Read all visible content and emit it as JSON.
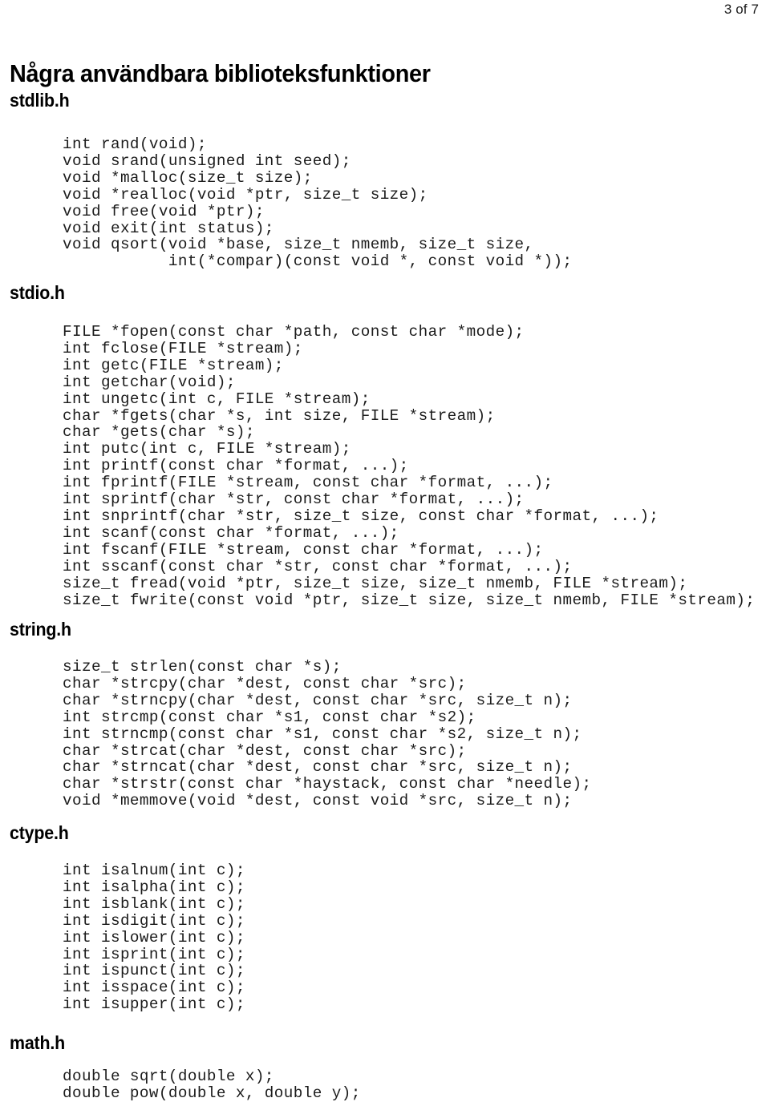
{
  "page": {
    "number_label": "3 of 7",
    "title": "Några användbara biblioteksfunktioner"
  },
  "sections": [
    {
      "heading": "stdlib.h",
      "code": "int rand(void);\nvoid srand(unsigned int seed);\nvoid *malloc(size_t size);\nvoid *realloc(void *ptr, size_t size);\nvoid free(void *ptr);\nvoid exit(int status);\nvoid qsort(void *base, size_t nmemb, size_t size,\n           int(*compar)(const void *, const void *));"
    },
    {
      "heading": "stdio.h",
      "code": "FILE *fopen(const char *path, const char *mode);\nint fclose(FILE *stream);\nint getc(FILE *stream);\nint getchar(void);\nint ungetc(int c, FILE *stream);\nchar *fgets(char *s, int size, FILE *stream);\nchar *gets(char *s);\nint putc(int c, FILE *stream);\nint printf(const char *format, ...);\nint fprintf(FILE *stream, const char *format, ...);\nint sprintf(char *str, const char *format, ...);\nint snprintf(char *str, size_t size, const char *format, ...);\nint scanf(const char *format, ...);\nint fscanf(FILE *stream, const char *format, ...);\nint sscanf(const char *str, const char *format, ...);\nsize_t fread(void *ptr, size_t size, size_t nmemb, FILE *stream);\nsize_t fwrite(const void *ptr, size_t size, size_t nmemb, FILE *stream);"
    },
    {
      "heading": "string.h",
      "code": "size_t strlen(const char *s);\nchar *strcpy(char *dest, const char *src);\nchar *strncpy(char *dest, const char *src, size_t n);\nint strcmp(const char *s1, const char *s2);\nint strncmp(const char *s1, const char *s2, size_t n);\nchar *strcat(char *dest, const char *src);\nchar *strncat(char *dest, const char *src, size_t n);\nchar *strstr(const char *haystack, const char *needle);\nvoid *memmove(void *dest, const void *src, size_t n);"
    },
    {
      "heading": "ctype.h",
      "code": "int isalnum(int c);\nint isalpha(int c);\nint isblank(int c);\nint isdigit(int c);\nint islower(int c);\nint isprint(int c);\nint ispunct(int c);\nint isspace(int c);\nint isupper(int c);"
    },
    {
      "heading": "math.h",
      "code": "double sqrt(double x);\ndouble pow(double x, double y);"
    }
  ],
  "colors": {
    "background": "#ffffff",
    "text": "#000000",
    "code_text": "#1b1b1b"
  }
}
